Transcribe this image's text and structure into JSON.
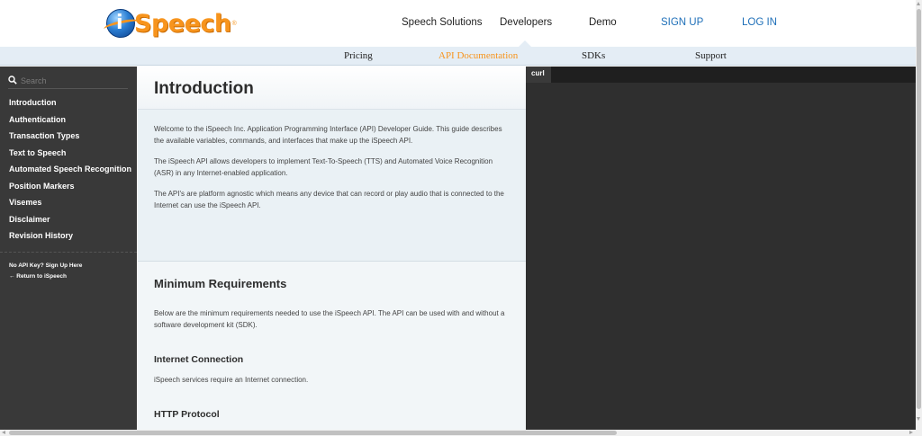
{
  "header": {
    "logo": {
      "prefix": "i",
      "text": "Speech",
      "tm": "®",
      "icon": "ispeech-logo-icon"
    },
    "nav": [
      {
        "label": "Speech Solutions"
      },
      {
        "label": "Developers"
      },
      {
        "label": "Demo"
      },
      {
        "label": "SIGN UP"
      },
      {
        "label": "LOG IN"
      }
    ]
  },
  "subnav": {
    "items": [
      {
        "label": "Pricing"
      },
      {
        "label": "API Documentation",
        "active": true
      },
      {
        "label": "SDKs"
      },
      {
        "label": "Support"
      }
    ]
  },
  "sidebar": {
    "search": {
      "placeholder": "Search",
      "icon": "search-icon"
    },
    "items": [
      {
        "label": "Introduction"
      },
      {
        "label": "Authentication"
      },
      {
        "label": "Transaction Types"
      },
      {
        "label": "Text to Speech"
      },
      {
        "label": "Automated Speech Recognition"
      },
      {
        "label": "Position Markers"
      },
      {
        "label": "Visemes"
      },
      {
        "label": "Disclaimer"
      },
      {
        "label": "Revision History"
      }
    ],
    "links": [
      {
        "label": "No API Key? Sign Up Here"
      },
      {
        "label": "← Return to iSpeech"
      }
    ]
  },
  "main": {
    "intro": {
      "title": "Introduction",
      "paragraphs": [
        "Welcome to the iSpeech Inc. Application Programming Interface (API) Developer Guide. This guide describes the available variables, commands, and interfaces that make up the iSpeech API.",
        "The iSpeech API allows developers to implement Text-To-Speech (TTS) and Automated Voice Recognition (ASR) in any Internet-enabled application.",
        "The API's are platform agnostic which means any device that can record or play audio that is connected to the Internet can use the iSpeech API."
      ]
    },
    "requirements": {
      "title": "Minimum Requirements",
      "paragraph": "Below are the minimum requirements needed to use the iSpeech API. The API can be used with and without a software development kit (SDK).",
      "internet": {
        "title": "Internet Connection",
        "paragraph": "iSpeech services require an Internet connection."
      },
      "http": {
        "title": "HTTP Protocol"
      }
    }
  },
  "code_panel": {
    "tab": "curl"
  },
  "colors": {
    "brand_orange": "#f7941d",
    "link_blue": "#1e6fb8",
    "sidebar_bg": "#393939",
    "code_bg": "#2f2f2f"
  }
}
